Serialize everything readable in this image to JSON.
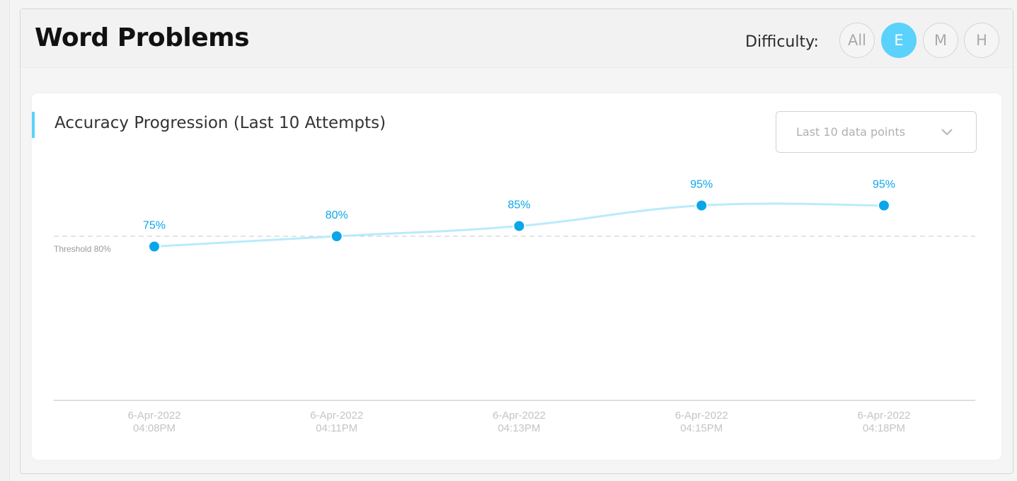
{
  "header": {
    "title": "Word Problems",
    "difficulty_label": "Difficulty:",
    "difficulty_options": [
      "All",
      "E",
      "M",
      "H"
    ],
    "selected_difficulty": "E"
  },
  "panel": {
    "title": "Accuracy Progression (Last 10 Attempts)",
    "range_select": {
      "value": "Last 10 data points",
      "icon": "chevron-down-icon"
    }
  },
  "colors": {
    "accent": "#5ad2fb",
    "point": "#0aa6ea",
    "line": "#b9ebfb",
    "label": "#0aa6ea",
    "threshold": "#c8c8c8",
    "tick": "#c4c4c4"
  },
  "chart_data": {
    "type": "line",
    "title": "Accuracy Progression (Last 10 Attempts)",
    "xlabel": "",
    "ylabel": "",
    "categories": [
      [
        "6-Apr-2022",
        "04:08PM"
      ],
      [
        "6-Apr-2022",
        "04:11PM"
      ],
      [
        "6-Apr-2022",
        "04:13PM"
      ],
      [
        "6-Apr-2022",
        "04:15PM"
      ],
      [
        "6-Apr-2022",
        "04:18PM"
      ]
    ],
    "series": [
      {
        "values": [
          75,
          80,
          85,
          95,
          95
        ],
        "data_labels": [
          "75%",
          "80%",
          "85%",
          "95%",
          "95%"
        ]
      }
    ],
    "threshold": {
      "value": 80,
      "label": "Threshold 80%"
    },
    "ylim": [
      0,
      100
    ],
    "grid": false,
    "legend": "none"
  }
}
